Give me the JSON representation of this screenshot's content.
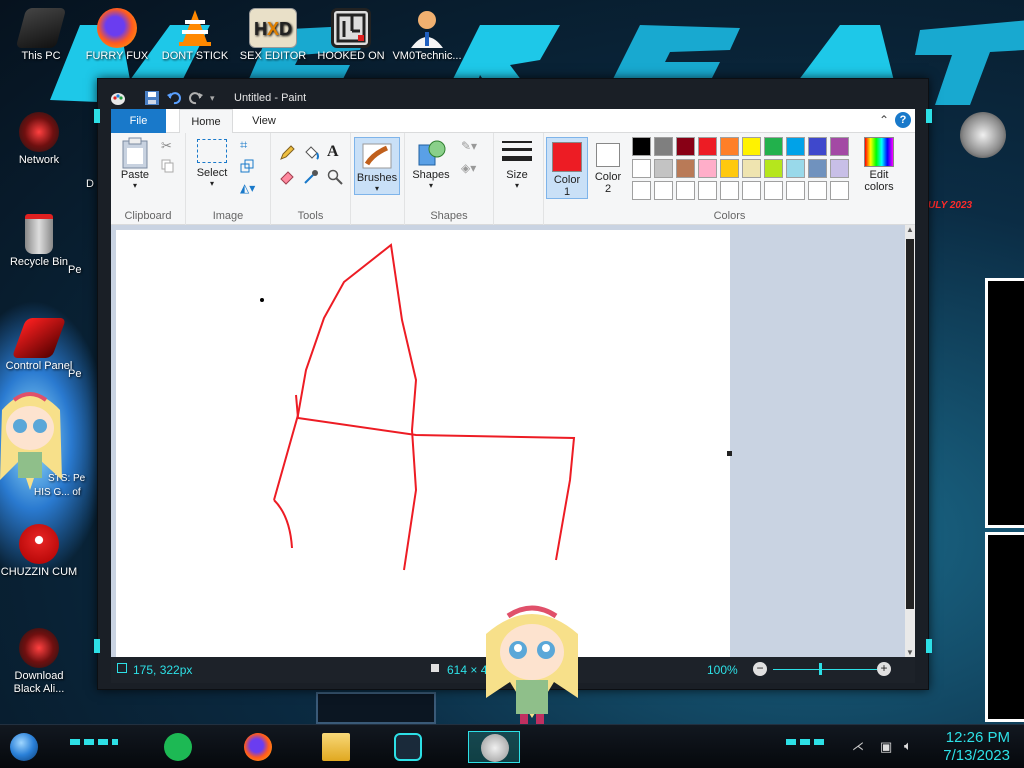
{
  "desktop": {
    "icons": [
      {
        "label": "This PC",
        "icon": "this-pc-icon"
      },
      {
        "label": "FURRY FUX",
        "icon": "firefox-icon"
      },
      {
        "label": "DONT STICK",
        "icon": "vlc-icon"
      },
      {
        "label": "SEX EDITOR",
        "icon": "hex-editor-icon"
      },
      {
        "label": "HOOKED ON",
        "icon": "maze-icon"
      },
      {
        "label": "VM0Technic...",
        "icon": "doctor-icon"
      },
      {
        "label": "Network",
        "icon": "network-icon"
      },
      {
        "label": "Recycle Bin",
        "icon": "recycle-bin-icon"
      },
      {
        "label": "Control Panel",
        "icon": "control-panel-icon"
      },
      {
        "label": "CHUZZIN CUM",
        "icon": "chuzzle-icon"
      },
      {
        "label": "Download Black Ali...",
        "icon": "alienware-icon"
      }
    ],
    "partial_labels": [
      "Pe",
      "Pe",
      "D",
      "STS: Pe",
      "HIS G... of"
    ],
    "wallpaper_text": "ULY 2023"
  },
  "window": {
    "title": "Untitled - Paint",
    "quick_access": [
      "paint-icon",
      "save-icon",
      "undo-icon",
      "redo-icon",
      "customize-icon"
    ]
  },
  "ribbon": {
    "tabs": {
      "file": "File",
      "home": "Home",
      "view": "View"
    },
    "clipboard": {
      "paste": "Paste",
      "group": "Clipboard"
    },
    "image": {
      "select": "Select",
      "group": "Image"
    },
    "tools": {
      "group": "Tools"
    },
    "brushes": {
      "label": "Brushes"
    },
    "shapes": {
      "label": "Shapes",
      "group": "Shapes"
    },
    "size": {
      "label": "Size"
    },
    "colors": {
      "color1_label": "Color",
      "color1_num": "1",
      "color2_label": "Color",
      "color2_num": "2",
      "edit_colors_line1": "Edit",
      "edit_colors_line2": "colors",
      "group": "Colors",
      "color1": "#ed1c24",
      "color2": "#ffffff",
      "palette_row1": [
        "#000000",
        "#7f7f7f",
        "#880015",
        "#ed1c24",
        "#ff7f27",
        "#fff200",
        "#22b14c",
        "#00a2e8",
        "#3f48cc",
        "#a349a4"
      ],
      "palette_row2": [
        "#ffffff",
        "#c3c3c3",
        "#b97a57",
        "#ffaec9",
        "#ffc90e",
        "#efe4b0",
        "#b5e61d",
        "#99d9ea",
        "#7092be",
        "#c8bfe7"
      ],
      "palette_row3": [
        "#ffffff",
        "#ffffff",
        "#ffffff",
        "#ffffff",
        "#ffffff",
        "#ffffff",
        "#ffffff",
        "#ffffff",
        "#ffffff",
        "#ffffff"
      ]
    }
  },
  "status": {
    "cursor_pos": "175, 322px",
    "canvas_size": "614 × 460",
    "zoom": "100%"
  },
  "taskbar": {
    "items": [
      "start-orb",
      "spotify-icon",
      "firefox-icon",
      "file-explorer-icon",
      "game-icon",
      "paint-icon"
    ],
    "time": "12:26 PM",
    "date": "7/13/2023"
  }
}
